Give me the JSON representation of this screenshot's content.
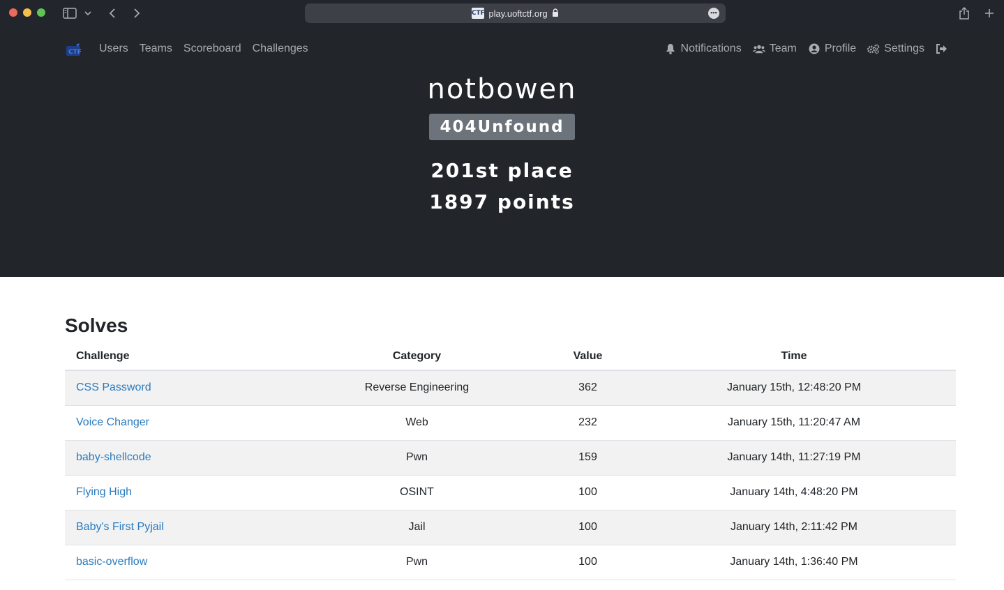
{
  "browser": {
    "url": "play.uoftctf.org",
    "favicon_text": "CTF"
  },
  "nav": {
    "left": [
      {
        "label": "Users"
      },
      {
        "label": "Teams"
      },
      {
        "label": "Scoreboard"
      },
      {
        "label": "Challenges"
      }
    ],
    "right": [
      {
        "label": "Notifications",
        "icon": "bell-icon"
      },
      {
        "label": "Team",
        "icon": "users-icon"
      },
      {
        "label": "Profile",
        "icon": "user-circle-icon"
      },
      {
        "label": "Settings",
        "icon": "gears-icon"
      }
    ],
    "logout_icon": "sign-out-icon"
  },
  "profile": {
    "username": "notbowen",
    "team": "404Unfound",
    "place": "201st place",
    "points": "1897 points"
  },
  "solves": {
    "title": "Solves",
    "columns": [
      "Challenge",
      "Category",
      "Value",
      "Time"
    ],
    "rows": [
      {
        "challenge": "CSS Password",
        "category": "Reverse Engineering",
        "value": "362",
        "time": "January 15th, 12:48:20 PM"
      },
      {
        "challenge": "Voice Changer",
        "category": "Web",
        "value": "232",
        "time": "January 15th, 11:20:47 AM"
      },
      {
        "challenge": "baby-shellcode",
        "category": "Pwn",
        "value": "159",
        "time": "January 14th, 11:27:19 PM"
      },
      {
        "challenge": "Flying High",
        "category": "OSINT",
        "value": "100",
        "time": "January 14th, 4:48:20 PM"
      },
      {
        "challenge": "Baby's First Pyjail",
        "category": "Jail",
        "value": "100",
        "time": "January 14th, 2:11:42 PM"
      },
      {
        "challenge": "basic-overflow",
        "category": "Pwn",
        "value": "100",
        "time": "January 14th, 1:36:40 PM"
      }
    ]
  },
  "colors": {
    "hero_bg": "#22252a",
    "link": "#2a7bbf",
    "badge": "#6c737b"
  }
}
